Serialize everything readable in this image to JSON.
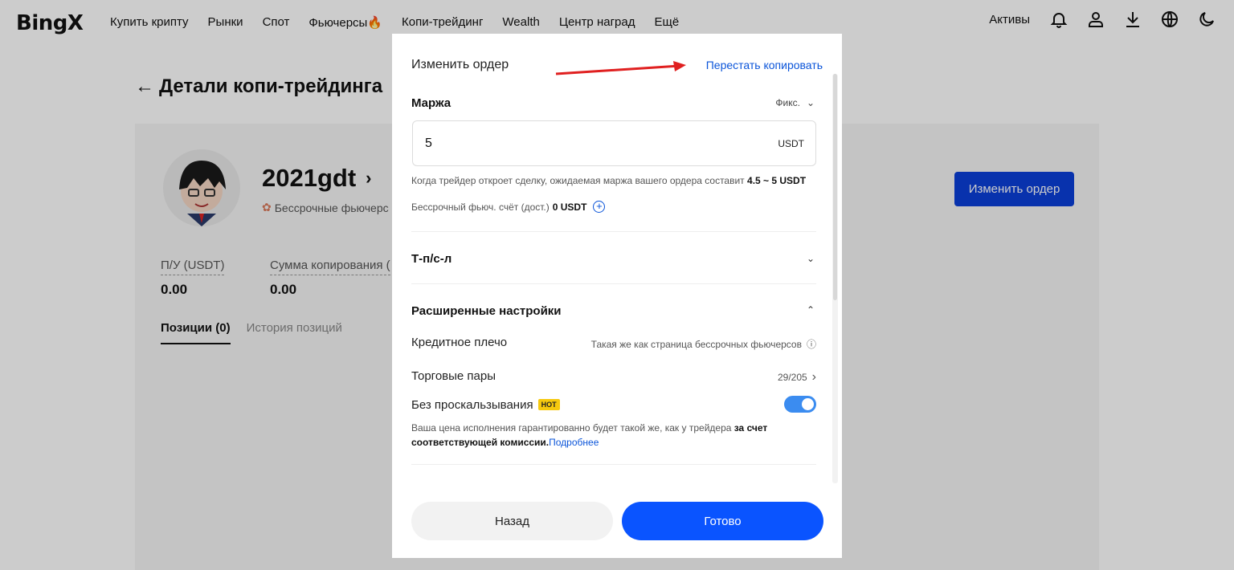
{
  "nav": {
    "logo": "BingX",
    "items": [
      "Купить крипту",
      "Рынки",
      "Спот",
      "Фьючерсы🔥",
      "Копи-трейдинг",
      "Wealth",
      "Центр наград",
      "Ещё"
    ],
    "assets": "Активы"
  },
  "page": {
    "title": "Детали копи-трейдинга",
    "trader_name": "2021gdt",
    "trader_sub": "Бессрочные фьючерс",
    "stats": [
      {
        "label": "П/У (USDT)",
        "value": "0.00"
      },
      {
        "label": "Сумма копирования (",
        "value": "0.00"
      }
    ],
    "tabs": [
      "Позиции (0)",
      "История позиций"
    ],
    "edit_order_button": "Изменить ордер"
  },
  "modal": {
    "title": "Изменить ордер",
    "stop_copy": "Перестать копировать",
    "margin": {
      "label": "Маржа",
      "mode": "Фикс.",
      "value": "5",
      "unit": "USDT",
      "hint_text": "Когда трейдер откроет сделку, ожидаемая маржа вашего ордера составит ",
      "hint_value": "4.5 ~ 5 USDT",
      "balance_label": "Бессрочный фьюч. счёт (дост.)",
      "balance_value": "0 USDT"
    },
    "tpsl_label": "Т-п/с-л",
    "advanced": {
      "label": "Расширенные настройки",
      "leverage_label": "Кредитное плечо",
      "leverage_value": "Такая же как страница бессрочных фьючерсов",
      "pairs_label": "Торговые пары",
      "pairs_value": "29/205",
      "slippage_label": "Без проскальзывания",
      "slippage_badge": "HOT",
      "slippage_enabled": true,
      "slippage_desc": "Ваша цена исполнения гарантированно будет такой же, как у трейдера ",
      "slippage_desc_bold": "за счет соответствующей комиссии.",
      "slippage_link": "Подробнее"
    },
    "back_button": "Назад",
    "done_button": "Готово"
  },
  "colors": {
    "primary": "#0a54ff",
    "link": "#0a54d9",
    "annotation_arrow": "#e02020",
    "hot_badge": "#f6c90e"
  }
}
